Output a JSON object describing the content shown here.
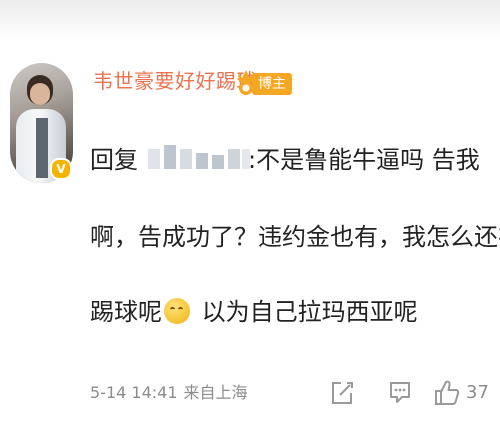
{
  "post": {
    "username": "韦世豪要好好踢球",
    "badge_label": "博主",
    "reply_prefix": "回复",
    "reply_rest": ":不是鲁能牛逼吗 告我",
    "line2": "啊，告成功了？违约金也有，我怎么还在",
    "line3_start": "踢球呢",
    "line3_end": " 以为自己拉玛西亚呢",
    "time": "5-14 14:41",
    "source": "来自上海",
    "like_count": "37"
  },
  "icons": {
    "avatar_verified": "verified-v-icon",
    "vip": "vip-crown-icon",
    "emoji": "grinning-face-icon",
    "edit": "edit-square-icon",
    "comment": "comment-bubble-icon",
    "like": "thumbs-up-icon"
  },
  "colors": {
    "username": "#eb7350",
    "badge": "#f5a623",
    "verified": "#f5b400",
    "meta_text": "#8c8c8c"
  }
}
